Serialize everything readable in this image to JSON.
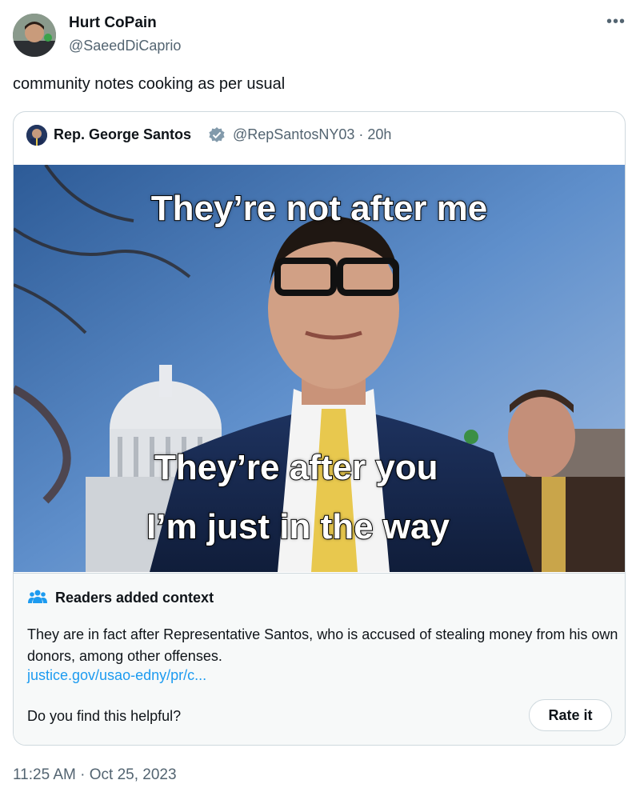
{
  "author": {
    "name": "Hurt CoPain",
    "handle": "@SaeedDiCaprio"
  },
  "tweet": {
    "text": "community notes cooking as per usual",
    "timestamp": "11:25 AM · Oct 25, 2023"
  },
  "quoted": {
    "name": "Rep. George Santos",
    "handle_time": "@RepSantosNY03 · 20h",
    "meme": {
      "line1": "They’re not after me",
      "line2": "They’re after you",
      "line3": "I’m just in the way"
    }
  },
  "context": {
    "title": "Readers added context",
    "body": "They are in fact after Representative Santos, who is accused of stealing money from his own donors, among other offenses.",
    "link": "justice.gov/usao-edny/pr/c...",
    "question": "Do you find this helpful?",
    "rate_label": "Rate it"
  },
  "icons": {
    "more": "more-icon",
    "verified": "verified-badge-icon",
    "readers": "people-icon"
  },
  "colors": {
    "link": "#1d9bf0",
    "secondary": "#536471",
    "border": "#cfd9de",
    "context_bg": "#f7f9f9"
  }
}
